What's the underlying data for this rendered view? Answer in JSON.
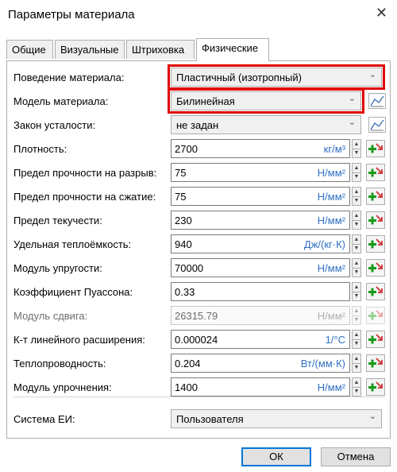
{
  "window": {
    "title": "Параметры материала",
    "close_glyph": "✕"
  },
  "tabs": [
    {
      "label": "Общие"
    },
    {
      "label": "Визуальные"
    },
    {
      "label": "Штриховка"
    },
    {
      "label": "Физические",
      "active": true
    }
  ],
  "behavior": {
    "label": "Поведение материала:",
    "value": "Пластичный (изотропный)",
    "highlighted": true
  },
  "model": {
    "label": "Модель материала:",
    "value": "Билинейная",
    "highlighted": true,
    "icon": "graph-icon"
  },
  "fatigue": {
    "label": "Закон усталости:",
    "value": "не задан",
    "icon": "graph-icon"
  },
  "properties": [
    {
      "label": "Плотность:",
      "value": "2700",
      "unit": "кг/м³",
      "enabled": true
    },
    {
      "label": "Предел прочности на разрыв:",
      "value": "75",
      "unit": "Н/мм²",
      "enabled": true
    },
    {
      "label": "Предел прочности на сжатие:",
      "value": "75",
      "unit": "Н/мм²",
      "enabled": true
    },
    {
      "label": "Предел текучести:",
      "value": "230",
      "unit": "Н/мм²",
      "enabled": true
    },
    {
      "label": "Удельная теплоёмкость:",
      "value": "940",
      "unit": "Дж/(кг·К)",
      "enabled": true
    },
    {
      "label": "Модуль упругости:",
      "value": "70000",
      "unit": "Н/мм²",
      "enabled": true
    },
    {
      "label": "Коэффициент Пуассона:",
      "value": "0.33",
      "unit": "",
      "enabled": true
    },
    {
      "label": "Модуль сдвига:",
      "value": "26315.79",
      "unit": "Н/мм²",
      "enabled": false
    },
    {
      "label": "К-т линейного расширения:",
      "value": "0.000024",
      "unit": "1/°С",
      "enabled": true
    },
    {
      "label": "Теплопроводность:",
      "value": "0.204",
      "unit": "Вт/(мм·К)",
      "enabled": true
    },
    {
      "label": "Модуль упрочнения:",
      "value": "1400",
      "unit": "Н/мм²",
      "enabled": true
    }
  ],
  "units_system": {
    "label": "Система ЕИ:",
    "value": "Пользователя"
  },
  "buttons": {
    "ok": "ОК",
    "cancel": "Отмена"
  },
  "colors": {
    "highlight": "#e00000",
    "unit_text": "#2e6fc4",
    "plus_green": "#1a9a1a",
    "arrow_red": "#d03030"
  },
  "glyphs": {
    "chevron": "⌄",
    "spin_up": "▲",
    "spin_down": "▼"
  }
}
